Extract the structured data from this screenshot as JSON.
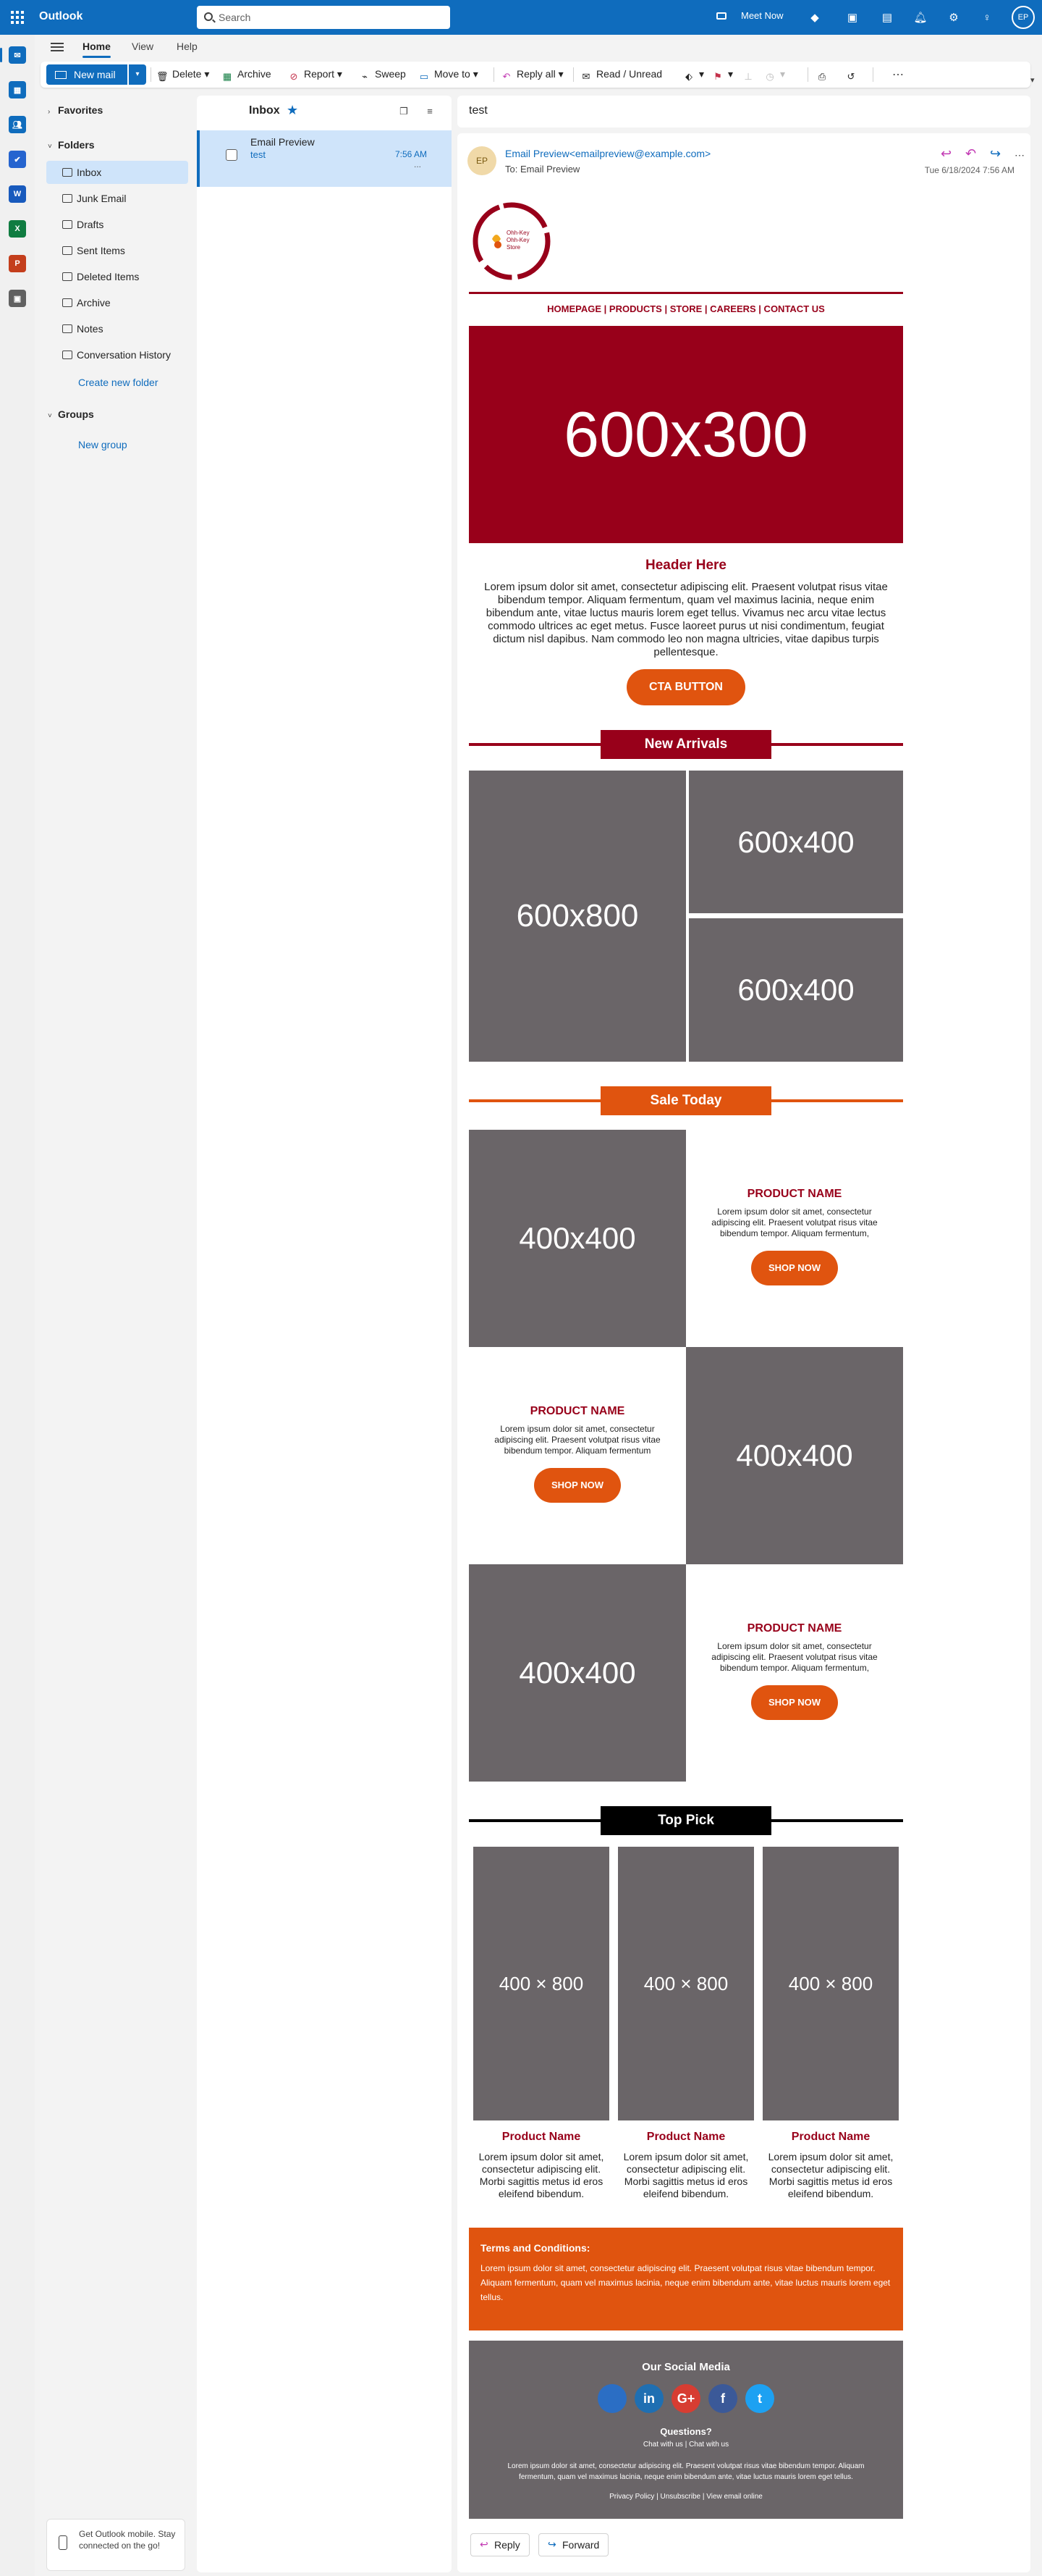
{
  "app": {
    "name": "Outlook"
  },
  "search": {
    "placeholder": "Search"
  },
  "topbar": {
    "meet_now": "Meet Now",
    "avatar_initials": "EP"
  },
  "rail": [
    {
      "name": "mail-icon",
      "color": "#0f6cbd"
    },
    {
      "name": "calendar-icon",
      "color": "#0f6cbd"
    },
    {
      "name": "people-icon",
      "color": "#0f6cbd"
    },
    {
      "name": "todo-icon",
      "color": "#2564cf"
    },
    {
      "name": "word-icon",
      "color": "#185abd"
    },
    {
      "name": "excel-icon",
      "color": "#107c41"
    },
    {
      "name": "powerpoint-icon",
      "color": "#c43e1c"
    },
    {
      "name": "apps-icon",
      "color": "#616161"
    }
  ],
  "ribbon": {
    "tabs": [
      "Home",
      "View",
      "Help"
    ]
  },
  "toolbar": {
    "new_mail": "New mail",
    "delete": "Delete",
    "archive": "Archive",
    "report": "Report",
    "sweep": "Sweep",
    "move_to": "Move to",
    "reply_all": "Reply all",
    "read_unread": "Read / Unread"
  },
  "folders": {
    "favorites": "Favorites",
    "folders": "Folders",
    "items": [
      "Inbox",
      "Junk Email",
      "Drafts",
      "Sent Items",
      "Deleted Items",
      "Archive",
      "Notes",
      "Conversation History"
    ],
    "create_new": "Create new folder",
    "groups": "Groups",
    "new_group": "New group",
    "mobile_promo": "Get Outlook mobile. Stay connected on the go!"
  },
  "message_list": {
    "title": "Inbox",
    "message": {
      "from": "Email Preview",
      "subject": "test",
      "time": "7:56 AM",
      "preview": "..."
    }
  },
  "reading": {
    "subject": "test",
    "avatar": "EP",
    "sender": "Email Preview<emailpreview@example.com>",
    "to_label": "To:",
    "to": "Email Preview",
    "date": "Tue 6/18/2024 7:56 AM",
    "reply": "Reply",
    "forward": "Forward"
  },
  "email": {
    "logo_text": [
      "Ohh-Key",
      "Ohh-Key",
      "Store"
    ],
    "nav": "HOMEPAGE | PRODUCTS | STORE | CAREERS | CONTACT US",
    "hero_placeholder": "600x300",
    "header": "Header Here",
    "body": "Lorem ipsum dolor sit amet, consectetur adipiscing elit. Praesent volutpat risus vitae bibendum tempor. Aliquam fermentum, quam vel maximus lacinia, neque enim bibendum ante, vitae luctus mauris lorem eget tellus. Vivamus nec arcu vitae lectus commodo ultrices ac eget metus. Fusce laoreet purus ut nisi condimentum, feugiat dictum nisl dapibus. Nam commodo leo non magna ultricies, vitae dapibus turpis pellentesque.",
    "cta": "CTA BUTTON",
    "new_arrivals": {
      "title": "New Arrivals",
      "color": "#98001a",
      "placeholders": [
        "600x800",
        "600x400",
        "600x400"
      ]
    },
    "sale": {
      "title": "Sale Today",
      "color": "#e0540f",
      "items": [
        {
          "placeholder": "400x400",
          "name": "PRODUCT NAME",
          "desc": "Lorem ipsum dolor sit amet, consectetur adipiscing elit. Praesent volutpat risus vitae bibendum tempor. Aliquam fermentum,",
          "button": "SHOP NOW"
        },
        {
          "placeholder": "400x400",
          "name": "PRODUCT NAME",
          "desc": "Lorem ipsum dolor sit amet, consectetur adipiscing elit. Praesent volutpat risus vitae bibendum tempor. Aliquam fermentum",
          "button": "SHOP NOW"
        },
        {
          "placeholder": "400x400",
          "name": "PRODUCT NAME",
          "desc": "Lorem ipsum dolor sit amet, consectetur adipiscing elit. Praesent volutpat risus vitae bibendum tempor. Aliquam fermentum,",
          "button": "SHOP NOW"
        }
      ]
    },
    "top_pick": {
      "title": "Top Pick",
      "color": "#000000",
      "items": [
        {
          "placeholder": "400 × 800",
          "name": "Product Name",
          "desc": "Lorem ipsum dolor sit amet, consectetur adipiscing elit. Morbi sagittis metus id eros eleifend bibendum."
        },
        {
          "placeholder": "400 × 800",
          "name": "Product Name",
          "desc": "Lorem ipsum dolor sit amet, consectetur adipiscing elit. Morbi sagittis metus id eros eleifend bibendum."
        },
        {
          "placeholder": "400 × 800",
          "name": "Product Name",
          "desc": "Lorem ipsum dolor sit amet, consectetur adipiscing elit. Morbi sagittis metus id eros eleifend bibendum."
        }
      ]
    },
    "terms": {
      "title": "Terms and Conditions:",
      "body": "Lorem ipsum dolor sit amet, consectetur adipiscing elit. Praesent volutpat risus vitae bibendum tempor. Aliquam fermentum, quam vel maximus lacinia, neque enim bibendum ante, vitae luctus mauris lorem eget tellus."
    },
    "footer": {
      "title": "Our Social Media",
      "socials": [
        {
          "name": "github-icon",
          "glyph": "",
          "color": "#2b6ec4"
        },
        {
          "name": "linkedin-icon",
          "glyph": "in",
          "color": "#1f6fb2"
        },
        {
          "name": "googleplus-icon",
          "glyph": "G+",
          "color": "#d73d32"
        },
        {
          "name": "facebook-icon",
          "glyph": "f",
          "color": "#3b5998"
        },
        {
          "name": "twitter-icon",
          "glyph": "t",
          "color": "#1da1f2"
        }
      ],
      "questions": "Questions?",
      "chat": "Chat with us | Chat with us",
      "body": "Lorem ipsum dolor sit amet, consectetur adipiscing elit. Praesent volutpat risus vitae bibendum tempor. Aliquam fermentum, quam vel maximus lacinia, neque enim bibendum ante, vitae luctus mauris lorem eget tellus.",
      "links": "Privacy Policy | Unsubscribe | View email online"
    }
  }
}
